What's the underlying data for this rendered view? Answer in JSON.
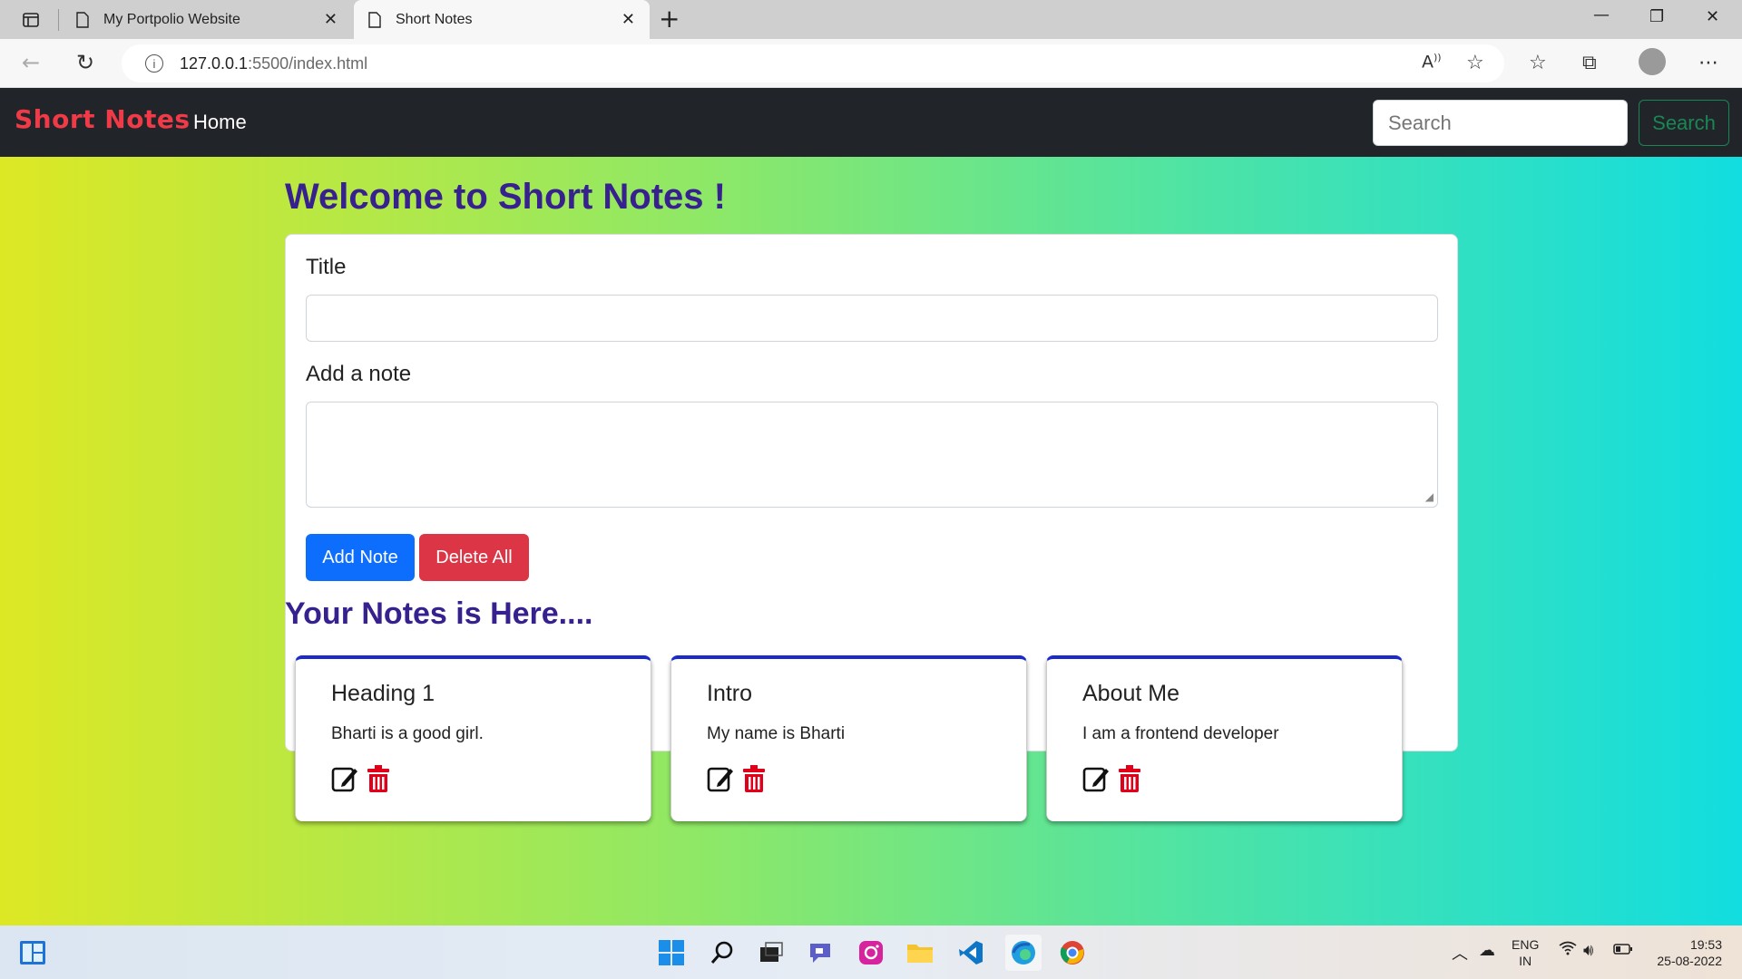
{
  "browser": {
    "tabs": [
      {
        "title": "My Portpolio Website"
      },
      {
        "title": "Short Notes"
      }
    ],
    "url": {
      "host": "127.0.0.1",
      "path": ":5500/index.html"
    }
  },
  "app": {
    "brand": "Short Notes",
    "nav": {
      "home": "Home"
    },
    "search": {
      "placeholder": "Search",
      "button": "Search"
    },
    "welcome": "Welcome to Short Notes !",
    "form": {
      "title_label": "Title",
      "note_label": "Add a note",
      "title_value": "",
      "note_value": "",
      "add_button": "Add Note",
      "delete_all_button": "Delete All"
    },
    "notes_heading": "Your Notes is Here....",
    "notes": [
      {
        "title": "Heading 1",
        "body": "Bharti is a good girl."
      },
      {
        "title": "Intro",
        "body": "My name is Bharti"
      },
      {
        "title": "About Me",
        "body": "I am a frontend developer"
      }
    ],
    "colors": {
      "brand": "#f03a47",
      "heading": "#37218e",
      "primary": "#0d6efd",
      "danger": "#dc3545",
      "success": "#198754",
      "note_border": "#1b2acb"
    }
  },
  "taskbar": {
    "lang": "ENG",
    "region": "IN",
    "time": "19:53",
    "date": "25-08-2022",
    "apps": [
      "windows-start-icon",
      "search-icon",
      "task-view-icon",
      "teams-chat-icon",
      "instagram-icon",
      "file-explorer-icon",
      "vscode-icon",
      "edge-icon",
      "chrome-icon"
    ]
  }
}
